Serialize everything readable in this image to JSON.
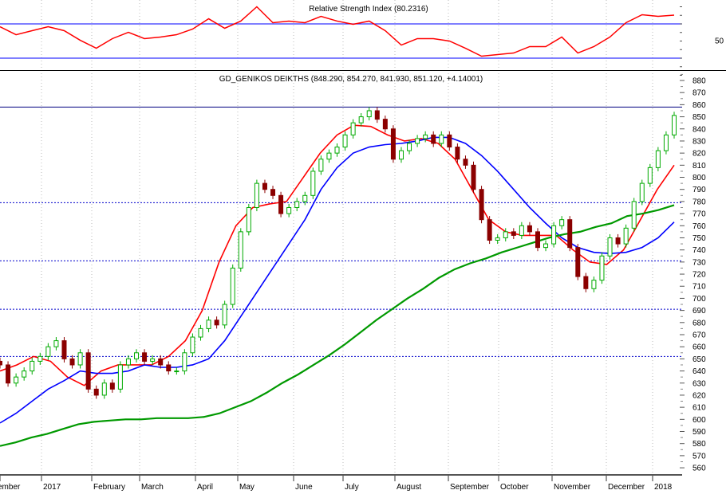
{
  "chart_data": [
    {
      "type": "line",
      "title": "Relative Strength Index (80.2316)",
      "yticks": [
        50
      ],
      "reference_lines": [
        70,
        30
      ],
      "x_sample_px_step_note": "samples evenly spaced across visible period",
      "values": [
        66.7,
        57.4,
        62.1,
        66.7,
        62.1,
        50.9,
        41.6,
        52.8,
        60.2,
        52.8,
        54.7,
        57.4,
        64.0,
        76.0,
        64.9,
        73.3,
        90.0,
        71.4,
        73.3,
        71.4,
        78.8,
        73.3,
        69.5,
        73.3,
        62.1,
        45.3,
        52.8,
        52.8,
        50.0,
        41.6,
        32.3,
        34.2,
        36.0,
        43.5,
        43.5,
        54.7,
        36.0,
        43.5,
        54.7,
        71.4,
        80.7,
        78.8,
        80.2
      ],
      "color": "#ff0000"
    },
    {
      "type": "candlestick",
      "title": "GD_GENIKOS DEIKTHS (848.290, 854.270, 841.930, 851.120, +4.14001)",
      "ylim": [
        555,
        885
      ],
      "yticks": [
        560,
        570,
        580,
        590,
        600,
        610,
        620,
        630,
        640,
        650,
        660,
        670,
        680,
        690,
        700,
        710,
        720,
        730,
        740,
        750,
        760,
        770,
        780,
        790,
        800,
        810,
        820,
        830,
        840,
        850,
        860,
        870,
        880
      ],
      "xticks": [
        "ember",
        "2017",
        "February",
        "March",
        "April",
        "May",
        "June",
        "July",
        "August",
        "September",
        "October",
        "November",
        "December",
        "2018"
      ],
      "closes": [
        645,
        630,
        635,
        640,
        648,
        652,
        660,
        665,
        650,
        645,
        655,
        625,
        620,
        630,
        625,
        645,
        650,
        655,
        648,
        650,
        645,
        640,
        640,
        655,
        668,
        675,
        682,
        678,
        695,
        725,
        755,
        775,
        795,
        790,
        785,
        770,
        775,
        780,
        785,
        805,
        815,
        820,
        825,
        835,
        845,
        850,
        855,
        848,
        840,
        815,
        822,
        828,
        832,
        835,
        828,
        835,
        825,
        815,
        810,
        790,
        765,
        748,
        750,
        755,
        752,
        760,
        755,
        742,
        745,
        760,
        765,
        742,
        718,
        708,
        715,
        735,
        750,
        745,
        758,
        780,
        795,
        808,
        822,
        835,
        851.12
      ],
      "horizontal_lines": {
        "solid": [
          858
        ],
        "dashed": [
          779,
          731,
          691,
          652
        ]
      },
      "series": [
        {
          "name": "short MA",
          "color": "#ff0000",
          "values": [
            640,
            645,
            652,
            648,
            635,
            628,
            640,
            645,
            645,
            645,
            652,
            665,
            690,
            730,
            760,
            775,
            778,
            780,
            800,
            820,
            835,
            843,
            842,
            835,
            830,
            832,
            828,
            815,
            790,
            765,
            755,
            752,
            752,
            752,
            740,
            730,
            728,
            740,
            765,
            790,
            810
          ]
        },
        {
          "name": "medium MA",
          "color": "#0000ff",
          "values": [
            597,
            605,
            615,
            625,
            632,
            640,
            638,
            638,
            640,
            645,
            643,
            643,
            645,
            650,
            665,
            685,
            705,
            725,
            745,
            765,
            790,
            808,
            820,
            825,
            827,
            828,
            830,
            833,
            833,
            828,
            818,
            805,
            790,
            775,
            762,
            750,
            742,
            738,
            737,
            738,
            742,
            750,
            763
          ]
        },
        {
          "name": "long MA",
          "color": "#009900",
          "values": [
            578,
            581,
            585,
            588,
            592,
            596,
            598,
            599,
            600,
            600,
            601,
            601,
            601,
            602,
            605,
            610,
            615,
            622,
            630,
            637,
            645,
            653,
            662,
            672,
            682,
            691,
            700,
            708,
            717,
            724,
            729,
            733,
            738,
            742,
            746,
            750,
            753,
            755,
            759,
            762,
            768,
            770,
            773,
            777
          ]
        }
      ]
    }
  ]
}
